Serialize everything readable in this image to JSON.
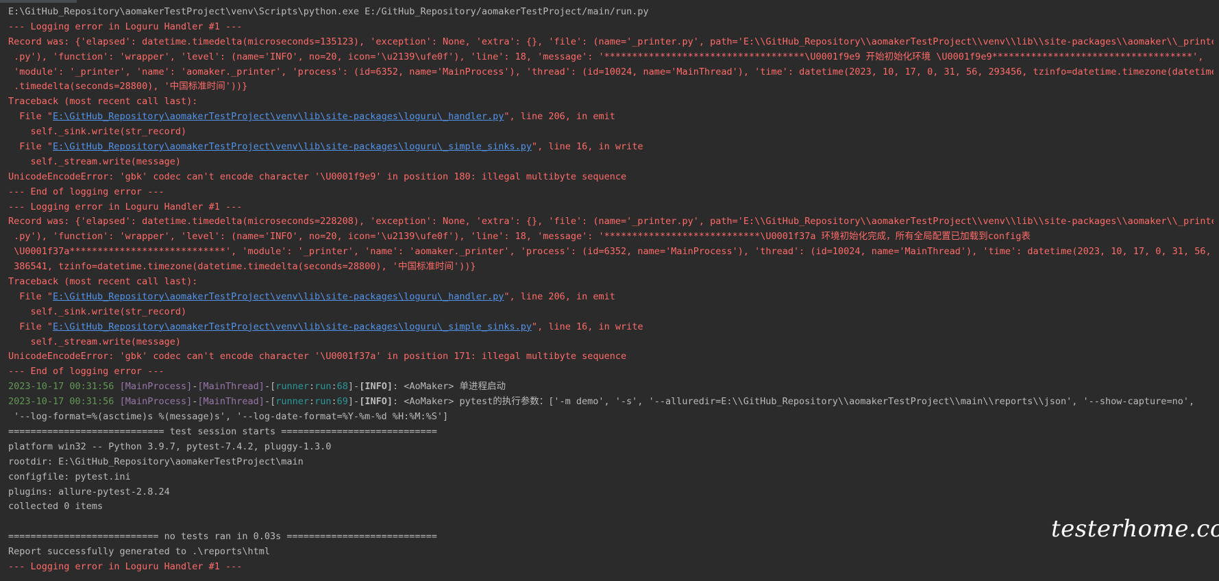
{
  "watermark": "testerhome.com",
  "lines": [
    [
      {
        "t": "E:\\GitHub_Repository\\aomakerTestProject\\venv\\Scripts\\python.exe E:/GitHub_Repository/aomakerTestProject/main/run.py",
        "c": "default"
      }
    ],
    [
      {
        "t": "--- Logging error in Loguru Handler #1 ---",
        "c": "error"
      }
    ],
    [
      {
        "t": "Record was: {'elapsed': datetime.timedelta(microseconds=135123), 'exception': None, 'extra': {}, 'file': (name='_printer.py', path='E:\\\\GitHub_Repository\\\\aomakerTestProject\\\\venv\\\\lib\\\\site-packages\\\\aomaker\\\\_printer",
        "c": "error"
      }
    ],
    [
      {
        "t": " .py'), 'function': 'wrapper', 'level': (name='INFO', no=20, icon='\\u2139\\ufe0f'), 'line': 18, 'message': '************************************\\U0001f9e9 开始初始化环境 \\U0001f9e9************************************',",
        "c": "error"
      }
    ],
    [
      {
        "t": " 'module': '_printer', 'name': 'aomaker._printer', 'process': (id=6352, name='MainProcess'), 'thread': (id=10024, name='MainThread'), 'time': datetime(2023, 10, 17, 0, 31, 56, 293456, tzinfo=datetime.timezone(datetime",
        "c": "error"
      }
    ],
    [
      {
        "t": " .timedelta(seconds=28800), '中国标准时间'))}",
        "c": "error"
      }
    ],
    [
      {
        "t": "Traceback (most recent call last):",
        "c": "error"
      }
    ],
    [
      {
        "t": "  File \"",
        "c": "error"
      },
      {
        "t": "E:\\GitHub_Repository\\aomakerTestProject\\venv\\lib\\site-packages\\loguru\\_handler.py",
        "c": "link"
      },
      {
        "t": "\", line 206, in emit",
        "c": "error"
      }
    ],
    [
      {
        "t": "    self._sink.write(str_record)",
        "c": "error"
      }
    ],
    [
      {
        "t": "  File \"",
        "c": "error"
      },
      {
        "t": "E:\\GitHub_Repository\\aomakerTestProject\\venv\\lib\\site-packages\\loguru\\_simple_sinks.py",
        "c": "link"
      },
      {
        "t": "\", line 16, in write",
        "c": "error"
      }
    ],
    [
      {
        "t": "    self._stream.write(message)",
        "c": "error"
      }
    ],
    [
      {
        "t": "UnicodeEncodeError: 'gbk' codec can't encode character '\\U0001f9e9' in position 180: illegal multibyte sequence",
        "c": "error"
      }
    ],
    [
      {
        "t": "--- End of logging error ---",
        "c": "error"
      }
    ],
    [
      {
        "t": "--- Logging error in Loguru Handler #1 ---",
        "c": "error"
      }
    ],
    [
      {
        "t": "Record was: {'elapsed': datetime.timedelta(microseconds=228208), 'exception': None, 'extra': {}, 'file': (name='_printer.py', path='E:\\\\GitHub_Repository\\\\aomakerTestProject\\\\venv\\\\lib\\\\site-packages\\\\aomaker\\\\_printer",
        "c": "error"
      }
    ],
    [
      {
        "t": " .py'), 'function': 'wrapper', 'level': (name='INFO', no=20, icon='\\u2139\\ufe0f'), 'line': 18, 'message': '****************************\\U0001f37a 环境初始化完成，所有全局配置已加载到config表",
        "c": "error"
      }
    ],
    [
      {
        "t": " \\U0001f37a****************************', 'module': '_printer', 'name': 'aomaker._printer', 'process': (id=6352, name='MainProcess'), 'thread': (id=10024, name='MainThread'), 'time': datetime(2023, 10, 17, 0, 31, 56,",
        "c": "error"
      }
    ],
    [
      {
        "t": " 386541, tzinfo=datetime.timezone(datetime.timedelta(seconds=28800), '中国标准时间'))}",
        "c": "error"
      }
    ],
    [
      {
        "t": "Traceback (most recent call last):",
        "c": "error"
      }
    ],
    [
      {
        "t": "  File \"",
        "c": "error"
      },
      {
        "t": "E:\\GitHub_Repository\\aomakerTestProject\\venv\\lib\\site-packages\\loguru\\_handler.py",
        "c": "link"
      },
      {
        "t": "\", line 206, in emit",
        "c": "error"
      }
    ],
    [
      {
        "t": "    self._sink.write(str_record)",
        "c": "error"
      }
    ],
    [
      {
        "t": "  File \"",
        "c": "error"
      },
      {
        "t": "E:\\GitHub_Repository\\aomakerTestProject\\venv\\lib\\site-packages\\loguru\\_simple_sinks.py",
        "c": "link"
      },
      {
        "t": "\", line 16, in write",
        "c": "error"
      }
    ],
    [
      {
        "t": "    self._stream.write(message)",
        "c": "error"
      }
    ],
    [
      {
        "t": "UnicodeEncodeError: 'gbk' codec can't encode character '\\U0001f37a' in position 171: illegal multibyte sequence",
        "c": "error"
      }
    ],
    [
      {
        "t": "--- End of logging error ---",
        "c": "error"
      }
    ],
    [
      {
        "t": "2023-10-17 00:31:56",
        "c": "time"
      },
      {
        "t": " ",
        "c": "default"
      },
      {
        "t": "[MainProcess]",
        "c": "purple"
      },
      {
        "t": "-",
        "c": "default"
      },
      {
        "t": "[MainThread]",
        "c": "purple"
      },
      {
        "t": "-[",
        "c": "default"
      },
      {
        "t": "runner",
        "c": "cyan"
      },
      {
        "t": ":",
        "c": "default"
      },
      {
        "t": "run",
        "c": "cyan"
      },
      {
        "t": ":",
        "c": "default"
      },
      {
        "t": "68",
        "c": "cyan"
      },
      {
        "t": "]-",
        "c": "default"
      },
      {
        "t": "[INFO]",
        "c": "bold"
      },
      {
        "t": ": <AoMaker> 单进程启动",
        "c": "default"
      }
    ],
    [
      {
        "t": "2023-10-17 00:31:56",
        "c": "time"
      },
      {
        "t": " ",
        "c": "default"
      },
      {
        "t": "[MainProcess]",
        "c": "purple"
      },
      {
        "t": "-",
        "c": "default"
      },
      {
        "t": "[MainThread]",
        "c": "purple"
      },
      {
        "t": "-[",
        "c": "default"
      },
      {
        "t": "runner",
        "c": "cyan"
      },
      {
        "t": ":",
        "c": "default"
      },
      {
        "t": "run",
        "c": "cyan"
      },
      {
        "t": ":",
        "c": "default"
      },
      {
        "t": "69",
        "c": "cyan"
      },
      {
        "t": "]-",
        "c": "default"
      },
      {
        "t": "[INFO]",
        "c": "bold"
      },
      {
        "t": ": <AoMaker> pytest的执行参数：['-m demo', '-s', '--alluredir=E:\\\\GitHub_Repository\\\\aomakerTestProject\\\\main\\\\reports\\\\json', '--show-capture=no',",
        "c": "default"
      }
    ],
    [
      {
        "t": " '--log-format=%(asctime)s %(message)s', '--log-date-format=%Y-%m-%d %H:%M:%S']",
        "c": "default"
      }
    ],
    [
      {
        "t": "============================ test session starts ============================",
        "c": "default"
      }
    ],
    [
      {
        "t": "platform win32 -- Python 3.9.7, pytest-7.4.2, pluggy-1.3.0",
        "c": "default"
      }
    ],
    [
      {
        "t": "rootdir: E:\\GitHub_Repository\\aomakerTestProject\\main",
        "c": "default"
      }
    ],
    [
      {
        "t": "configfile: pytest.ini",
        "c": "default"
      }
    ],
    [
      {
        "t": "plugins: allure-pytest-2.8.24",
        "c": "default"
      }
    ],
    [
      {
        "t": "collected 0 items",
        "c": "default"
      }
    ],
    [
      {
        "t": "",
        "c": "default"
      }
    ],
    [
      {
        "t": "=========================== no tests ran in 0.03s ===========================",
        "c": "default"
      }
    ],
    [
      {
        "t": "Report successfully generated to .\\reports\\html",
        "c": "default"
      }
    ],
    [
      {
        "t": "--- Logging error in Loguru Handler #1 ---",
        "c": "error"
      }
    ]
  ]
}
